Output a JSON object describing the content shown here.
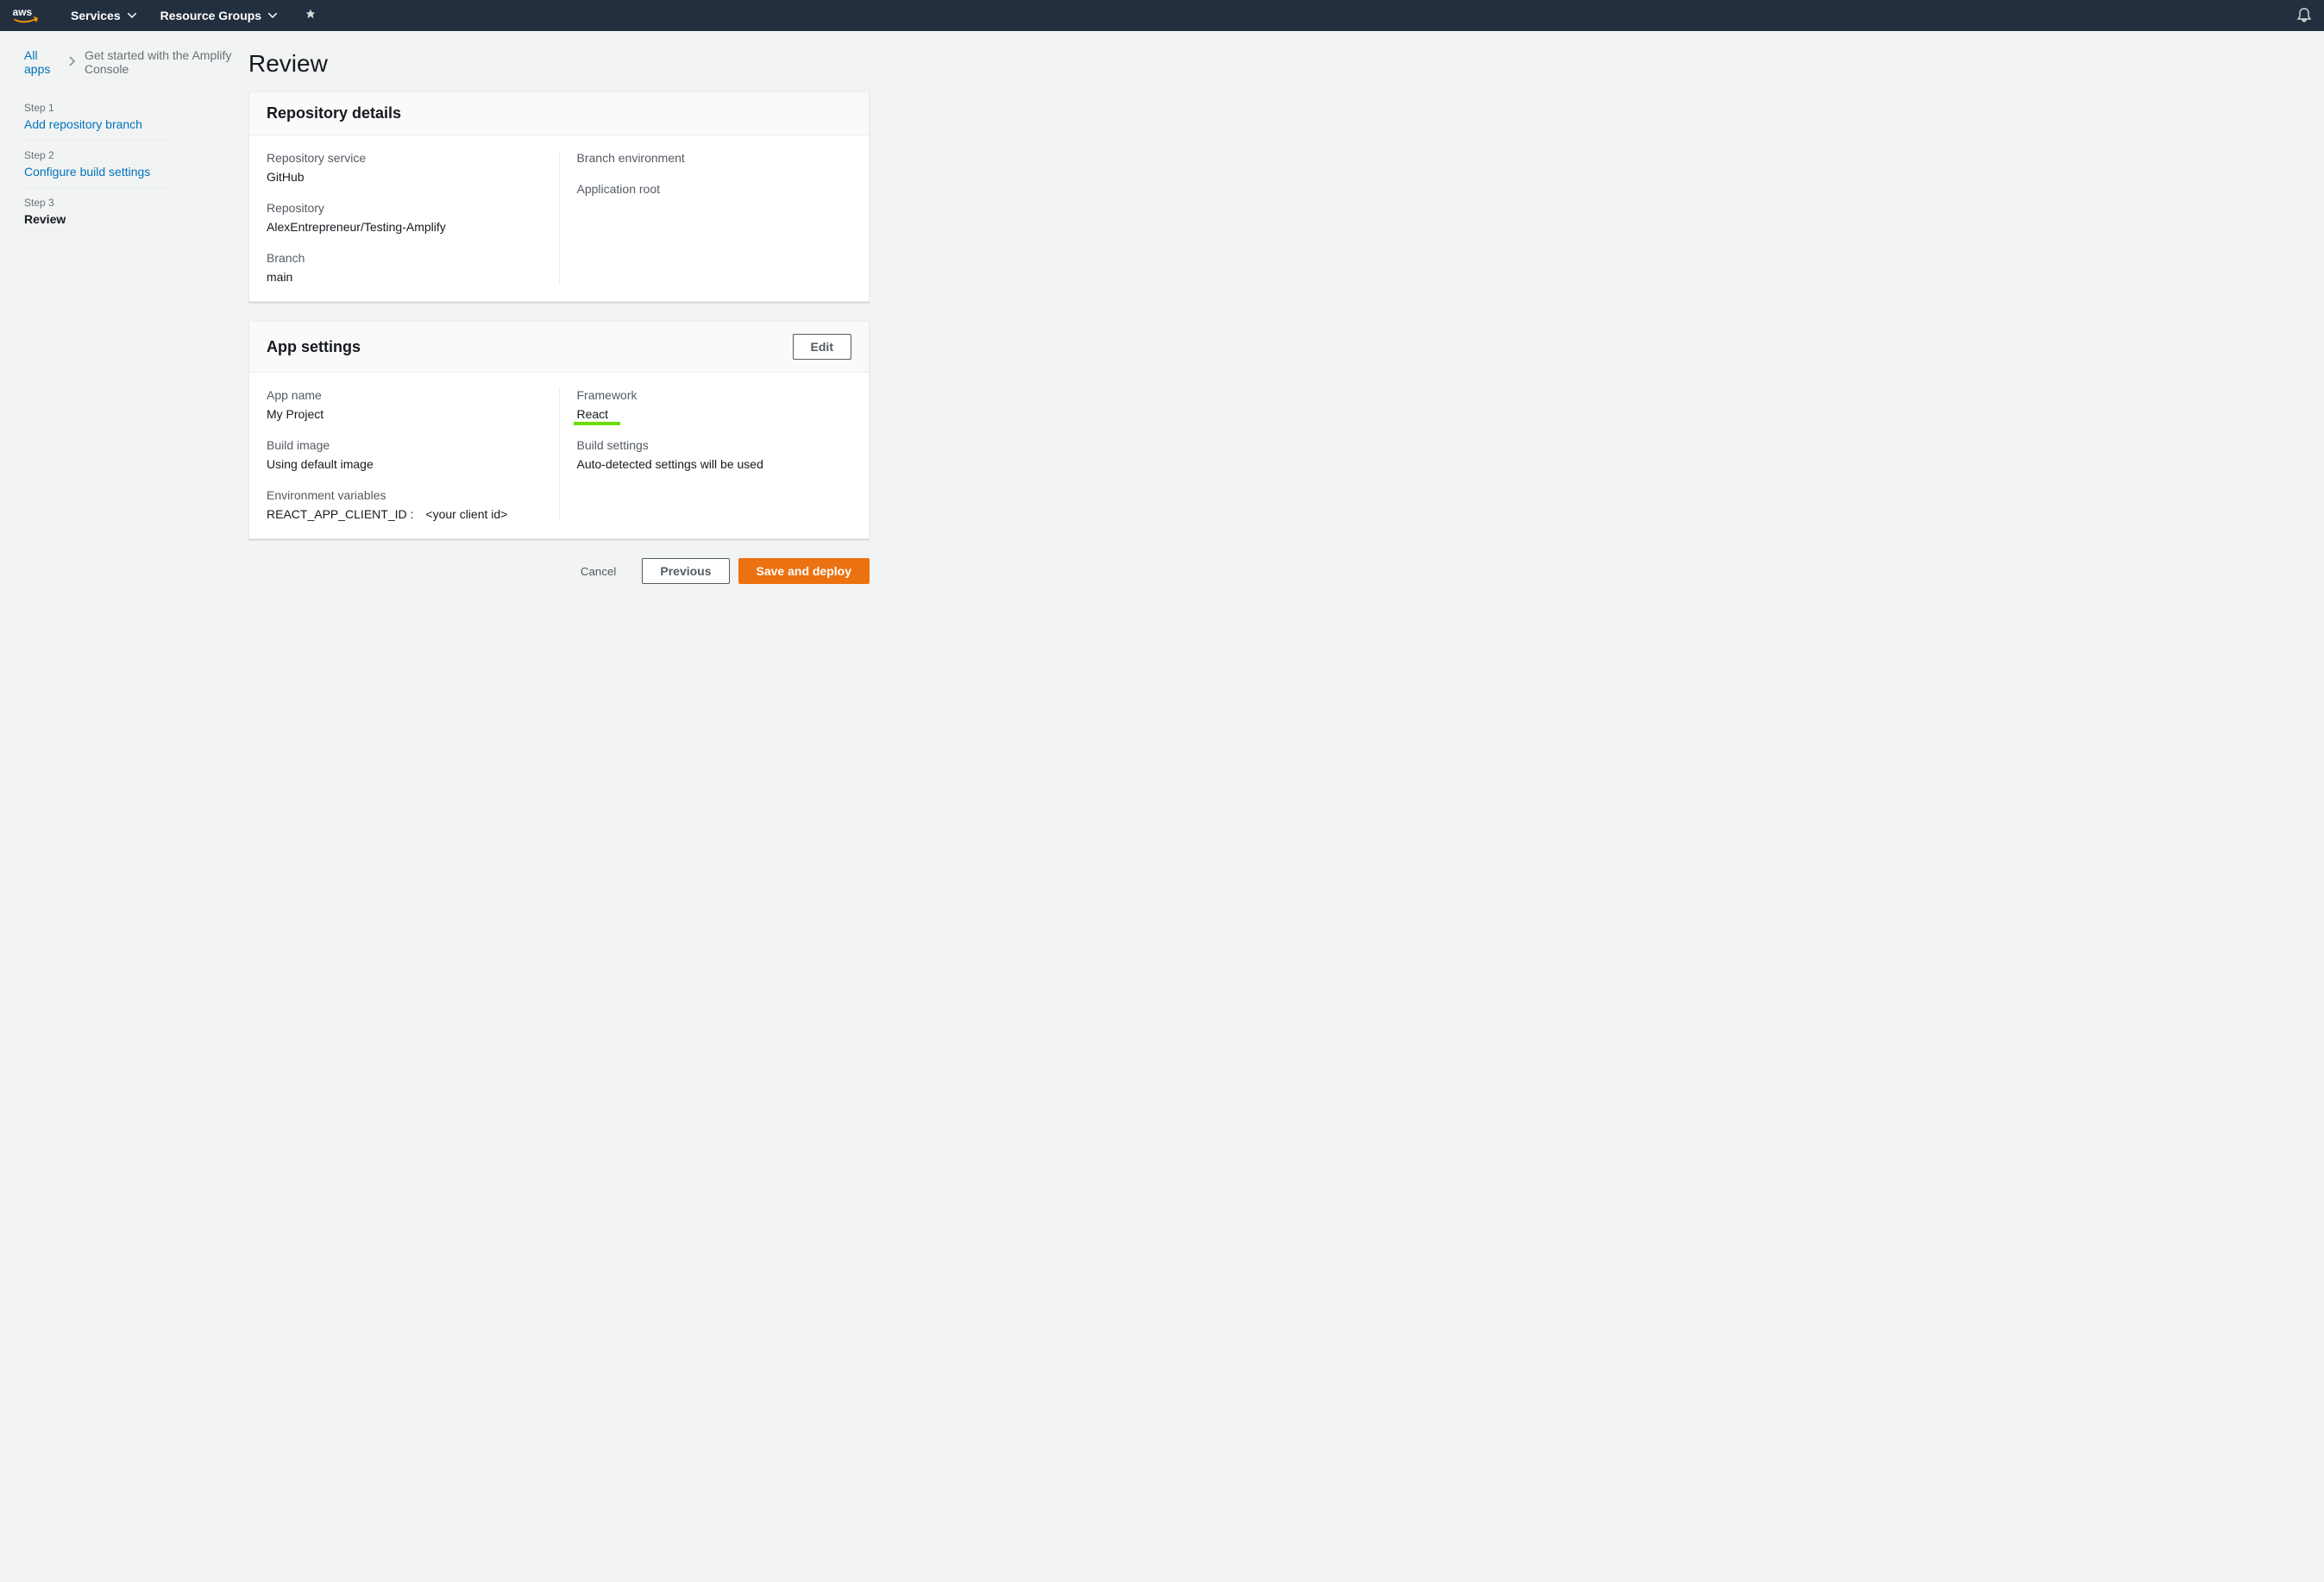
{
  "topnav": {
    "services": "Services",
    "resource_groups": "Resource Groups"
  },
  "breadcrumb": {
    "root": "All apps",
    "current": "Get started with the Amplify Console"
  },
  "steps": [
    {
      "num": "Step 1",
      "label": "Add repository branch",
      "current": false
    },
    {
      "num": "Step 2",
      "label": "Configure build settings",
      "current": false
    },
    {
      "num": "Step 3",
      "label": "Review",
      "current": true
    }
  ],
  "page_title": "Review",
  "panels": {
    "repo": {
      "title": "Repository details",
      "left": [
        {
          "label": "Repository service",
          "value": "GitHub"
        },
        {
          "label": "Repository",
          "value": "AlexEntrepreneur/Testing-Amplify"
        },
        {
          "label": "Branch",
          "value": "main"
        }
      ],
      "right": [
        {
          "label": "Branch environment",
          "value": ""
        },
        {
          "label": "Application root",
          "value": ""
        }
      ]
    },
    "app": {
      "title": "App settings",
      "edit": "Edit",
      "left": [
        {
          "label": "App name",
          "value": "My Project"
        },
        {
          "label": "Build image",
          "value": "Using default image"
        }
      ],
      "env_label": "Environment variables",
      "env_key": "REACT_APP_CLIENT_ID :",
      "env_val": "<your client id>",
      "right": [
        {
          "label": "Framework",
          "value": "React",
          "highlight": true
        },
        {
          "label": "Build settings",
          "value": "Auto-detected settings will be used"
        }
      ]
    }
  },
  "actions": {
    "cancel": "Cancel",
    "previous": "Previous",
    "save": "Save and deploy"
  }
}
